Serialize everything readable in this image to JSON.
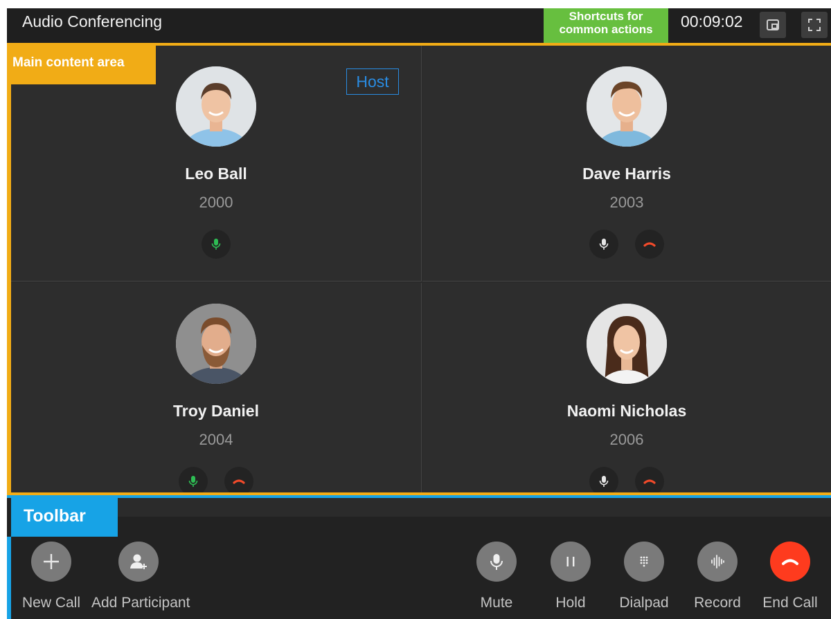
{
  "header": {
    "title": "Audio Conferencing",
    "shortcuts_label": "Shortcuts for common actions",
    "timer": "00:09:02",
    "pip_icon": "picture-in-picture-icon",
    "fullscreen_icon": "fullscreen-icon"
  },
  "main": {
    "area_label": "Main content area",
    "host_badge": "Host",
    "participants": [
      {
        "name": "Leo Ball",
        "extension": "2000",
        "mic": "active",
        "hangup": false
      },
      {
        "name": "Dave Harris",
        "extension": "2003",
        "mic": "idle",
        "hangup": true
      },
      {
        "name": "Troy Daniel",
        "extension": "2004",
        "mic": "active",
        "hangup": true
      },
      {
        "name": "Naomi Nicholas",
        "extension": "2006",
        "mic": "idle",
        "hangup": true
      }
    ]
  },
  "toolbar": {
    "label": "Toolbar",
    "new_call": "New Call",
    "add_participant": "Add Participant",
    "mute": "Mute",
    "hold": "Hold",
    "dialpad": "Dialpad",
    "record": "Record",
    "end_call": "End Call"
  },
  "colors": {
    "main_label": "#f1ac16",
    "toolbar_label": "#17a3e6",
    "shortcuts_label": "#67bf3f",
    "mic_active": "#2ebd54",
    "hangup": "#f24a2a",
    "end_call": "#fe3b1e",
    "host_badge": "#2a8ce2"
  }
}
